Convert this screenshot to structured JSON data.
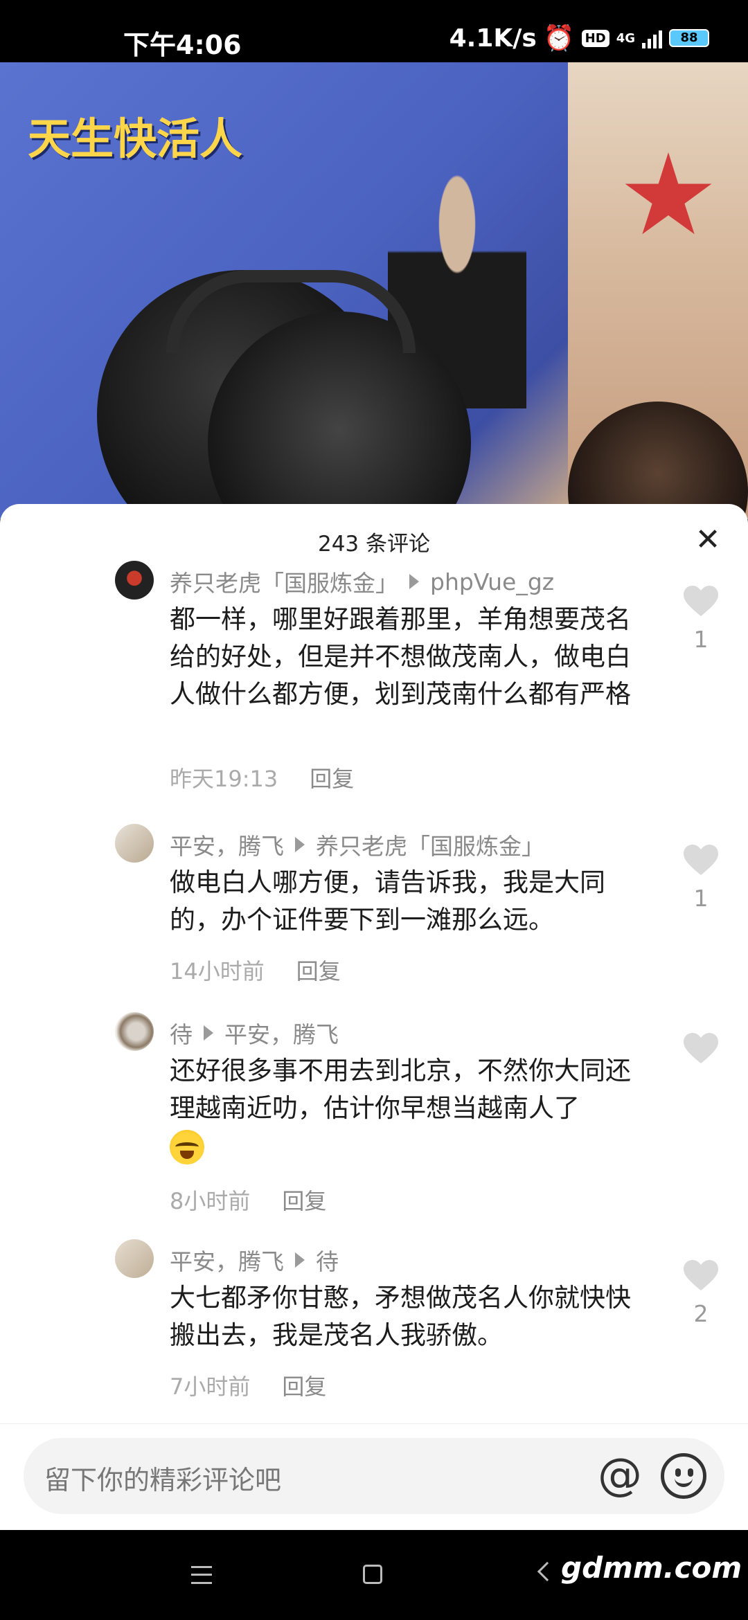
{
  "status_bar": {
    "time": "下午4:06",
    "net_speed": "4.1K/s",
    "hd_badge": "HD",
    "network": "4G",
    "battery": "88"
  },
  "comments_sheet": {
    "title": "243 条评论",
    "close_glyph": "✕"
  },
  "comments": [
    {
      "author": "养只老虎「国服炼金」",
      "reply_to": "phpVue_gz",
      "text": "都一样，哪里好跟着那里，羊角想要茂名给的好处，但是并不想做茂南人，做电白人做什么都方便，划到茂南什么都有严格",
      "time": "昨天19:13",
      "reply_label": "回复",
      "likes": "1"
    },
    {
      "author": "平安，腾飞",
      "reply_to": "养只老虎「国服炼金」",
      "text": "做电白人哪方便，请告诉我，我是大同的，办个证件要下到一滩那么远。",
      "time": "14小时前",
      "reply_label": "回复",
      "likes": "1"
    },
    {
      "author": "待",
      "reply_to": "平安，腾飞",
      "text": "还好很多事不用去到北京，不然你大同还理越南近叻，估计你早想当越南人了",
      "time": "8小时前",
      "reply_label": "回复",
      "likes": ""
    },
    {
      "author": "平安，腾飞",
      "reply_to": "待",
      "text": "大七都矛你甘憨，矛想做茂名人你就快快搬出去，我是茂名人我骄傲。",
      "time": "7小时前",
      "reply_label": "回复",
      "likes": "2"
    }
  ],
  "input": {
    "placeholder": "留下你的精彩评论吧",
    "at_glyph": "@"
  },
  "watermark": "gdmm.com",
  "icons": {
    "alarm": "alarm-icon",
    "signal": "signal-icon",
    "battery": "battery-icon",
    "like": "heart-icon",
    "emoji": "smile-icon",
    "mention": "at-icon"
  }
}
